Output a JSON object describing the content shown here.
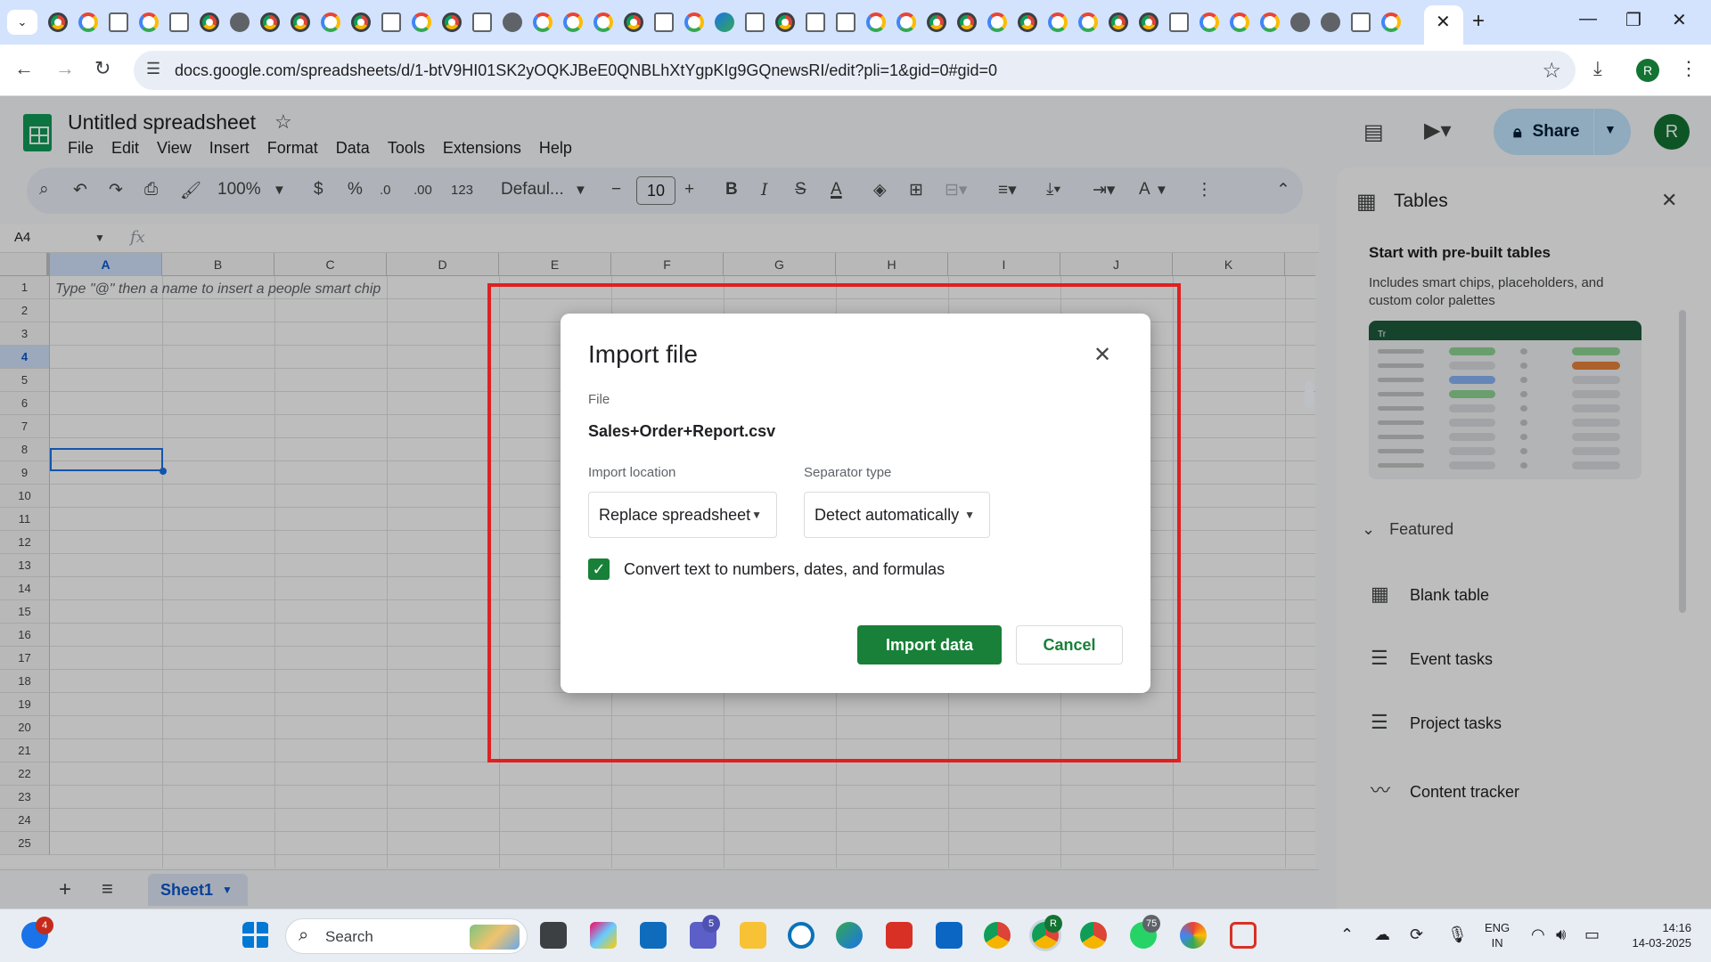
{
  "browser": {
    "url": "docs.google.com/spreadsheets/d/1-btV9HI01SK2yOQKJBeE0QNBLhXtYgpKIg9GQnewsRI/edit?pli=1&gid=0#gid=0",
    "profile_initial": "R",
    "icons": {
      "tab_search": "chevron-down-icon",
      "back": "arrow-left-icon",
      "forward": "arrow-right-icon",
      "reload": "reload-icon",
      "bookmark": "star-icon",
      "download": "download-icon",
      "menu": "kebab-icon"
    }
  },
  "app": {
    "title": "Untitled spreadsheet",
    "menu": [
      "File",
      "Edit",
      "View",
      "Insert",
      "Format",
      "Data",
      "Tools",
      "Extensions",
      "Help"
    ],
    "share_label": "Share",
    "avatar_initial": "R",
    "colors": {
      "accent": "#188038",
      "share_bg": "#c2e7ff",
      "selection": "#1a73e8",
      "highlight_box": "#e02020"
    }
  },
  "toolbar": {
    "zoom": "100%",
    "currency": "$",
    "percent": "%",
    "decimal_decrease": ".0",
    "decimal_increase": ".00",
    "number_format": "123",
    "font": "Defaul...",
    "font_size": "10",
    "bold": "B",
    "italic": "I",
    "strike": "S",
    "text_color": "A",
    "text_rotation": "A"
  },
  "formula_bar": {
    "cell_ref": "A4",
    "fx_label": "fx"
  },
  "grid": {
    "columns": [
      "A",
      "B",
      "C",
      "D",
      "E",
      "F",
      "G",
      "H",
      "I",
      "J",
      "K"
    ],
    "rows": [
      "1",
      "2",
      "3",
      "4",
      "5",
      "6",
      "7",
      "8",
      "9",
      "10",
      "11",
      "12",
      "13",
      "14",
      "15",
      "16",
      "17",
      "18",
      "19",
      "20",
      "21",
      "22",
      "23",
      "24",
      "25"
    ],
    "selected_column": "A",
    "selected_row": "4",
    "hint_text": "Type \"@\" then a name to insert a people smart chip"
  },
  "sheet_tabs": {
    "active": "Sheet1"
  },
  "tables_panel": {
    "title": "Tables",
    "subtitle": "Start with pre-built tables",
    "description": "Includes smart chips, placeholders, and custom color palettes",
    "featured_label": "Featured",
    "items": [
      {
        "label": "Blank table",
        "icon": "table-icon"
      },
      {
        "label": "Event tasks",
        "icon": "checklist-icon"
      },
      {
        "label": "Project tasks",
        "icon": "checklist-icon"
      },
      {
        "label": "Content tracker",
        "icon": "trend-icon"
      }
    ],
    "preview_header": "Tr"
  },
  "dialog": {
    "title": "Import file",
    "file_label": "File",
    "file_name": "Sales+Order+Report.csv",
    "import_location_label": "Import location",
    "import_location_value": "Replace spreadsheet",
    "separator_label": "Separator type",
    "separator_value": "Detect automatically",
    "convert_label": "Convert text to numbers, dates, and formulas",
    "convert_checked": true,
    "import_button": "Import data",
    "cancel_button": "Cancel"
  },
  "taskbar": {
    "search_label": "Search",
    "badges": {
      "outlook": "4",
      "teams": "5",
      "chrome_profile": "R",
      "whatsapp": "75"
    },
    "language": "ENG",
    "region": "IN",
    "time": "14:16",
    "date": "14-03-2025"
  }
}
